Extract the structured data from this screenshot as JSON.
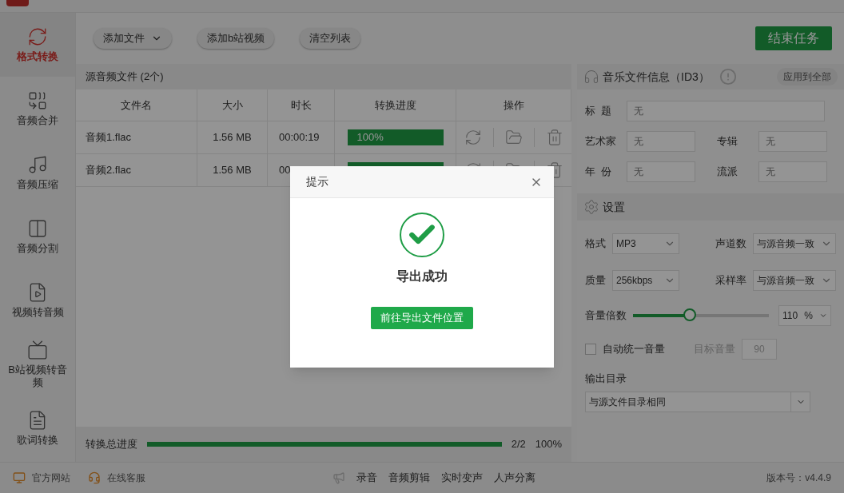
{
  "sidebar": {
    "items": [
      {
        "label": "格式转换",
        "selected": true
      },
      {
        "label": "音频合并",
        "selected": false
      },
      {
        "label": "音频压缩",
        "selected": false
      },
      {
        "label": "音频分割",
        "selected": false
      },
      {
        "label": "视频转音频",
        "selected": false
      },
      {
        "label": "B站视频转音频",
        "selected": false
      },
      {
        "label": "歌词转换",
        "selected": false
      }
    ]
  },
  "toolbar": {
    "buttons": [
      "添加文件",
      "添加b站视频",
      "清空列表"
    ],
    "end_button": "结束任务"
  },
  "file_panel": {
    "title": "源音频文件 (2个)",
    "columns": [
      "文件名",
      "大小",
      "时长",
      "转换进度",
      "操作"
    ],
    "rows": [
      {
        "name": "音频1.flac",
        "size": "1.56 MB",
        "duration": "00:00:19",
        "level": 1,
        "progress": "100%"
      },
      {
        "name": "音频2.flac",
        "size": "1.56 MB",
        "duration": "00",
        "level": 1,
        "progress": ""
      }
    ],
    "total_label": "转换总进度",
    "total_progress": {
      "level": 1
    },
    "total_count": "2/2",
    "total_percent": "100%"
  },
  "id3": {
    "title": "音乐文件信息（ID3）",
    "apply_button": "应用到全部",
    "fields": [
      {
        "label": "标  题",
        "placeholder": "无"
      },
      {
        "label": "艺术家",
        "placeholder": "无"
      },
      {
        "label": "专辑",
        "placeholder": "无"
      },
      {
        "label": "年  份",
        "placeholder": "无"
      },
      {
        "label": "流派",
        "placeholder": "无"
      }
    ]
  },
  "settings": {
    "title": "设置",
    "selects": [
      {
        "label": "格式",
        "value": "MP3"
      },
      {
        "label": "声道数",
        "value": "与源音频一致"
      },
      {
        "label": "质量",
        "value": "256kbps"
      },
      {
        "label": "采样率",
        "value": "与源音频一致"
      }
    ],
    "volume": {
      "label": "音量倍数",
      "level": 0.42,
      "value": "110",
      "unit": "%"
    },
    "normalize": {
      "label": "自动统一音量",
      "checked": false,
      "target_label": "目标音量",
      "target_value": "90"
    },
    "output": {
      "label": "输出目录",
      "value": "与源文件目录相同"
    }
  },
  "footer": {
    "left": [
      "官方网站",
      "在线客服"
    ],
    "tools": [
      "录音",
      "音频剪辑",
      "实时变声",
      "人声分离"
    ],
    "version": "版本号：v4.4.9"
  },
  "dialog": {
    "title": "提示",
    "message": "导出成功",
    "button": "前往导出文件位置"
  }
}
